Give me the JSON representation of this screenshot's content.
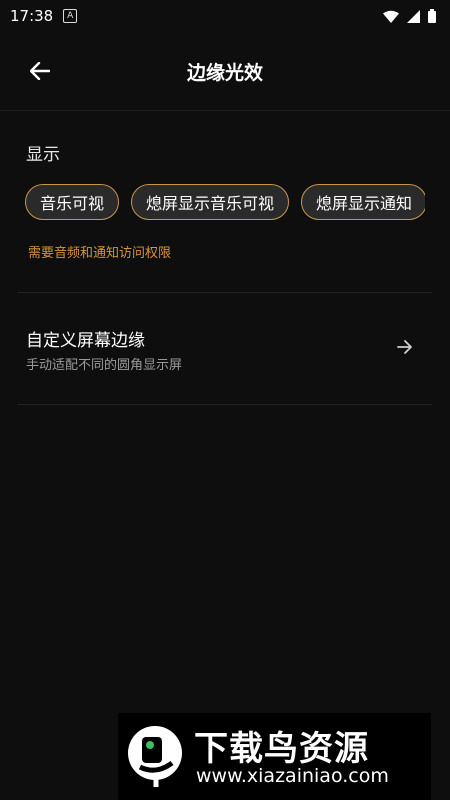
{
  "status_bar": {
    "time": "17:38",
    "notification_icon": "A"
  },
  "app_bar": {
    "title": "边缘光效",
    "back_icon": "arrow-left-icon"
  },
  "display": {
    "label": "显示",
    "chips": [
      {
        "label": "音乐可视"
      },
      {
        "label": "熄屏显示音乐可视"
      },
      {
        "label": "熄屏显示通知"
      }
    ],
    "hint": "需要音频和通知访问权限"
  },
  "custom_edge": {
    "title": "自定义屏幕边缘",
    "subtitle": "手动适配不同的圆角显示屏",
    "arrow_icon": "arrow-right-icon"
  },
  "watermark": {
    "title": "下载鸟资源",
    "url": "www.xiazainiao.com"
  },
  "colors": {
    "accent": "#c8964a",
    "hint": "#d69436",
    "background": "#0e0e0e"
  }
}
